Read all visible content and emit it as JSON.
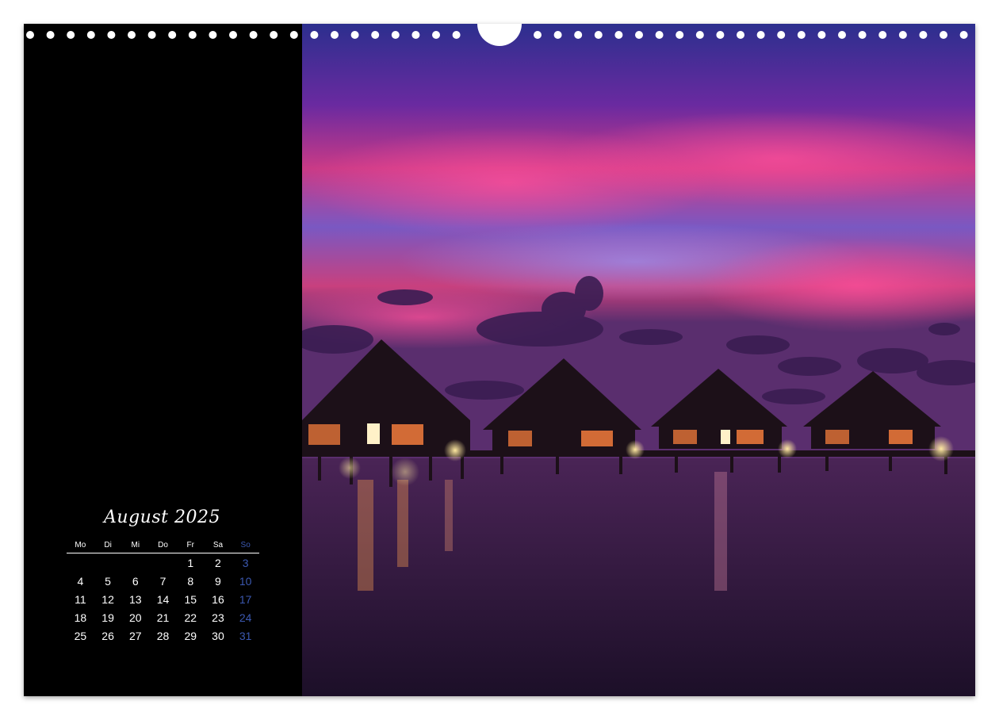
{
  "calendar": {
    "month_title": "August 2025",
    "weekdays": [
      "Mo",
      "Di",
      "Mi",
      "Do",
      "Fr",
      "Sa",
      "So"
    ],
    "weeks": [
      [
        "",
        "",
        "",
        "",
        "1",
        "2",
        "3"
      ],
      [
        "4",
        "5",
        "6",
        "7",
        "8",
        "9",
        "10"
      ],
      [
        "11",
        "12",
        "13",
        "14",
        "15",
        "16",
        "17"
      ],
      [
        "18",
        "19",
        "20",
        "21",
        "22",
        "23",
        "24"
      ],
      [
        "25",
        "26",
        "27",
        "28",
        "29",
        "30",
        "31"
      ]
    ]
  },
  "colors": {
    "sunday": "#3b58b0",
    "panel": "#000000",
    "sky_top": "#3a2a8a",
    "sky_glow": "#d63a7a",
    "water": "#2a1638"
  },
  "photo": {
    "subject": "overwater-bungalows-at-sunset"
  }
}
